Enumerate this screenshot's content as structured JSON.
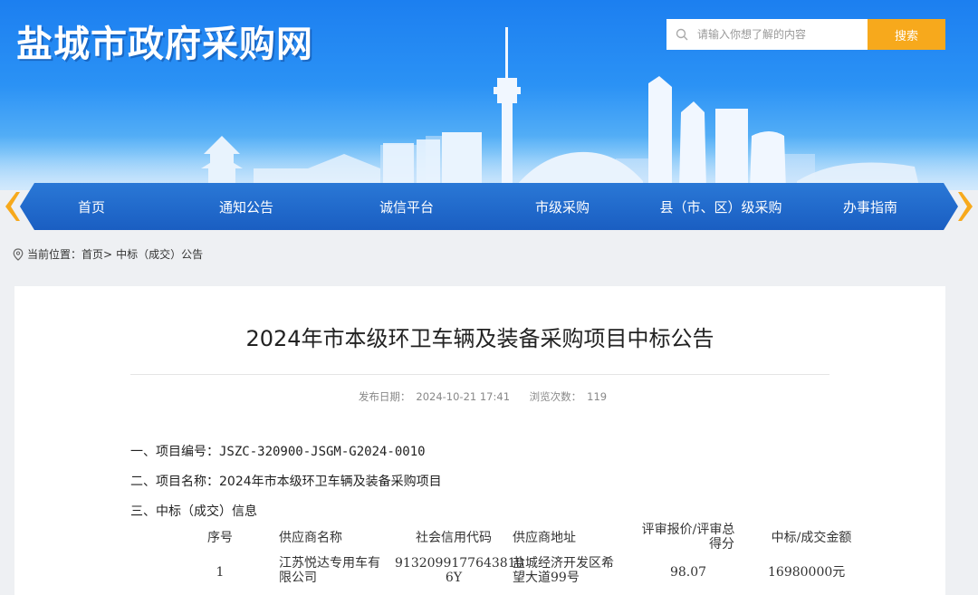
{
  "header": {
    "site_title": "盐城市政府采购网",
    "search": {
      "placeholder": "请输入你想了解的内容",
      "button_label": "搜索"
    }
  },
  "nav": {
    "items": [
      {
        "label": "首页"
      },
      {
        "label": "通知公告"
      },
      {
        "label": "诚信平台"
      },
      {
        "label": "市级采购"
      },
      {
        "label": "县（市、区）级采购"
      },
      {
        "label": "办事指南"
      }
    ]
  },
  "breadcrumb": {
    "prefix": "当前位置：",
    "home": "首页",
    "separator": ">",
    "current": "中标（成交）公告"
  },
  "article": {
    "title": "2024年市本级环卫车辆及装备采购项目中标公告",
    "publish_date_label": "发布日期：",
    "publish_date": "2024-10-21 17:41",
    "views_label": "浏览次数：",
    "views": "119",
    "item1_label": "一、项目编号：",
    "item1_value": "JSZC-320900-JSGM-G2024-0010",
    "item2_label": "二、项目名称：",
    "item2_value": "2024年市本级环卫车辆及装备采购项目",
    "item3_label": "三、中标（成交）信息"
  },
  "table": {
    "headers": {
      "seq": "序号",
      "supplier": "供应商名称",
      "credit_code": "社会信用代码",
      "address": "供应商地址",
      "score_l1": "评审报价/评审总",
      "score_l2": "得分",
      "amount": "中标/成交金额"
    },
    "row": {
      "seq": "1",
      "supplier_l1": "江苏悦达专用车有",
      "supplier_l2": "限公司",
      "credit_l1": "9132099177643810",
      "credit_l2": "6Y",
      "address_l1": "盐城经济开发区希",
      "address_l2": "望大道99号",
      "score": "98.07",
      "amount": "16980000元"
    }
  },
  "colors": {
    "brand_blue": "#1a5ec2",
    "accent_orange": "#f7a91c"
  }
}
